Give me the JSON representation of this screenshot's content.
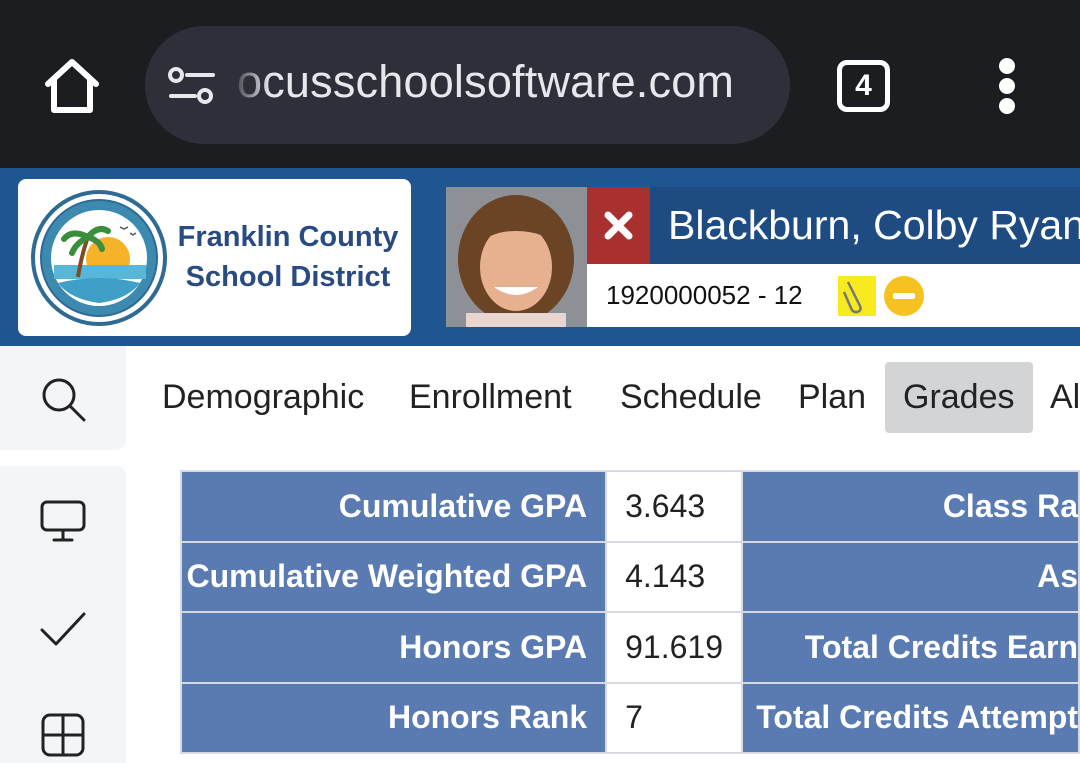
{
  "browser": {
    "url_text": "ocusschoolsoftware.com",
    "tab_count": "4"
  },
  "header": {
    "district_line1": "Franklin County",
    "district_line2": "School District",
    "student_name": "Blackburn, Colby Ryan",
    "student_id": "1920000052 - 12"
  },
  "tabs": [
    "Demographic",
    "Enrollment",
    "Schedule",
    "Plan",
    "Grades",
    "Al"
  ],
  "active_tab": "Grades",
  "gpa_table": {
    "rows": [
      {
        "label": "Cumulative GPA",
        "value": "3.643",
        "right_label": "Class Ra"
      },
      {
        "label": "Cumulative Weighted GPA",
        "value": "4.143",
        "right_label": "As"
      },
      {
        "label": "Honors GPA",
        "value": "91.619",
        "right_label": "Total Credits Earn"
      },
      {
        "label": "Honors Rank",
        "value": "7",
        "right_label": "Total Credits Attempt"
      }
    ]
  },
  "colors": {
    "header_blue": "#1f5691",
    "name_bar": "#1e4c82",
    "close_red": "#a8302f",
    "table_label_bg": "#5a7ab2",
    "chrome_bg": "#1c1d21"
  },
  "icons": [
    "home-icon",
    "site-settings-icon",
    "tabs-icon",
    "more-menu-icon",
    "close-icon",
    "note-icon",
    "alert-icon",
    "search-icon",
    "monitor-icon",
    "check-icon",
    "grid-icon"
  ]
}
